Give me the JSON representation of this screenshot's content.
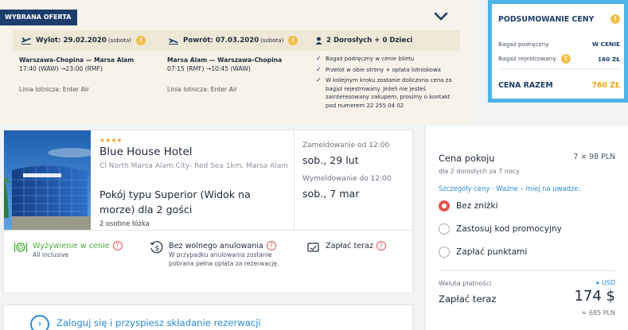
{
  "offer": {
    "tag": "WYBRANA OFERTA",
    "outbound_label": "Wylot: 29.02.2020",
    "outbound_day": "(sobota)",
    "return_label": "Powrót: 07.03.2020",
    "return_day": "(sobota)",
    "pax": "2 Dorosłych + 0 Dzieci",
    "outbound": {
      "route": "Warszawa-Chopina — Marsa Alam",
      "times": "17:40 (WAW) →23:00 (RMF)",
      "airline": "Linia lotnicza: Enter Air"
    },
    "return": {
      "route": "Marsa Alam — Warszawa-Chopina",
      "times": "07:15 (RMF) →10:45 (WAW)",
      "airline": "Linia lotnicza: Enter Air"
    },
    "checks": [
      "Bagaż podręczny w cenie biletu",
      "Przelot w obie strony + opłata lotniskowa",
      "W kolejnym kroku zostanie doliczona cena za bagaż rejestrowany. Jeżeli nie jesteś zainteresowany zakupem, prosimy o kontakt pod numerem 22 255 04 02"
    ]
  },
  "summary": {
    "title": "PODSUMOWANIE CENY",
    "carry_on_label": "Bagaż podręczny",
    "carry_on_value": "W CENIE",
    "checked_label": "Bagaż rejestrowany",
    "checked_value": "160 ZŁ",
    "total_label": "CENA RAZEM",
    "total_value": "760 ZŁ"
  },
  "hotel": {
    "stars": "★★★★",
    "name": "Blue House Hotel",
    "address": "Cl North Marsa Alam City- Red Sea 1km, Marsa Alam",
    "room": "Pokój typu Superior (Widok na morze) dla 2 gości",
    "beds": "2 osobne łóżka",
    "checkin_label": "Zameldowanie od 12:00",
    "checkin_date": "sob., 29 lut",
    "checkout_label": "Wymeldowanie do 12:00",
    "checkout_date": "sob., 7 mar",
    "meal_title": "Wyżywienie w cenie",
    "meal_sub": "All inclusive",
    "cancel_title": "Bez wolnego anulowania",
    "cancel_sub": "W przypadku anulowania zostanie pobrana pełna opłata za rezerwację.",
    "pay_now": "Zapłać teraz"
  },
  "login": {
    "text": "Zaloguj się i przyspiesz składanie rezerwacji"
  },
  "price": {
    "title": "Cena pokoju",
    "nights": "7 × 98 PLN",
    "sub": "dla 2 dorosłych  za 7 nocy",
    "links": "Szczegóły ceny  ·  Ważne – miej na uwadze:",
    "opt1": "Bez zniżki",
    "opt2": "Zastosuj kod promocyjny",
    "opt3": "Zapłać punktami",
    "currency_label": "Waluta płatności",
    "currency_value": "▸ USD",
    "pay_label": "Zapłać teraz",
    "pay_value": "174 $",
    "pay_pln": "≈ 685 PLN"
  }
}
